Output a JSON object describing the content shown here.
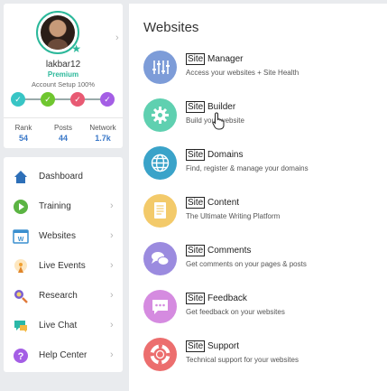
{
  "profile": {
    "username": "lakbar12",
    "tier": "Premium",
    "setup_text": "Account Setup 100%",
    "steps": [
      {
        "color": "#38c5c5",
        "icon": "check-icon"
      },
      {
        "color": "#6fc62f",
        "icon": "check-icon"
      },
      {
        "color": "#e85a73",
        "icon": "check-icon"
      },
      {
        "color": "#a45ee5",
        "icon": "check-icon"
      }
    ],
    "stats": [
      {
        "label": "Rank",
        "value": "54"
      },
      {
        "label": "Posts",
        "value": "44"
      },
      {
        "label": "Network",
        "value": "1.7k"
      }
    ]
  },
  "nav": {
    "items": [
      {
        "label": "Dashboard",
        "icon": "home-icon",
        "color": "#2d6fb8"
      },
      {
        "label": "Training",
        "icon": "play-icon",
        "color": "#5bb443"
      },
      {
        "label": "Websites",
        "icon": "website-icon",
        "color": "#3a8fcf"
      },
      {
        "label": "Live Events",
        "icon": "broadcast-icon",
        "color": "#f0a030"
      },
      {
        "label": "Research",
        "icon": "research-icon",
        "color": "#7a5ed1"
      },
      {
        "label": "Live Chat",
        "icon": "chat-icon",
        "color": "#2bb8a8"
      },
      {
        "label": "Help Center",
        "icon": "help-icon",
        "color": "#a45ee5"
      }
    ]
  },
  "websites": {
    "title": "Websites",
    "items": [
      {
        "prefix": "Site",
        "title": "Manager",
        "desc": "Access your websites + Site Health",
        "color": "#7d9cd8",
        "icon": "sliders-icon"
      },
      {
        "prefix": "Site",
        "title": "Builder",
        "desc": "Build your website",
        "color": "#5fd0b0",
        "icon": "gear-icon"
      },
      {
        "prefix": "Site",
        "title": "Domains",
        "desc": "Find, register & manage your domains",
        "color": "#3aa3c9",
        "icon": "globe-icon"
      },
      {
        "prefix": "Site",
        "title": "Content",
        "desc": "The Ultimate Writing Platform",
        "color": "#f3ca6a",
        "icon": "document-icon"
      },
      {
        "prefix": "Site",
        "title": "Comments",
        "desc": "Get comments on your pages & posts",
        "color": "#9b8bdf",
        "icon": "comments-icon"
      },
      {
        "prefix": "Site",
        "title": "Feedback",
        "desc": "Get feedback on your websites",
        "color": "#d58be0",
        "icon": "feedback-icon"
      },
      {
        "prefix": "Site",
        "title": "Support",
        "desc": "Technical support for your websites",
        "color": "#ec6e6e",
        "icon": "lifebuoy-icon"
      }
    ]
  }
}
